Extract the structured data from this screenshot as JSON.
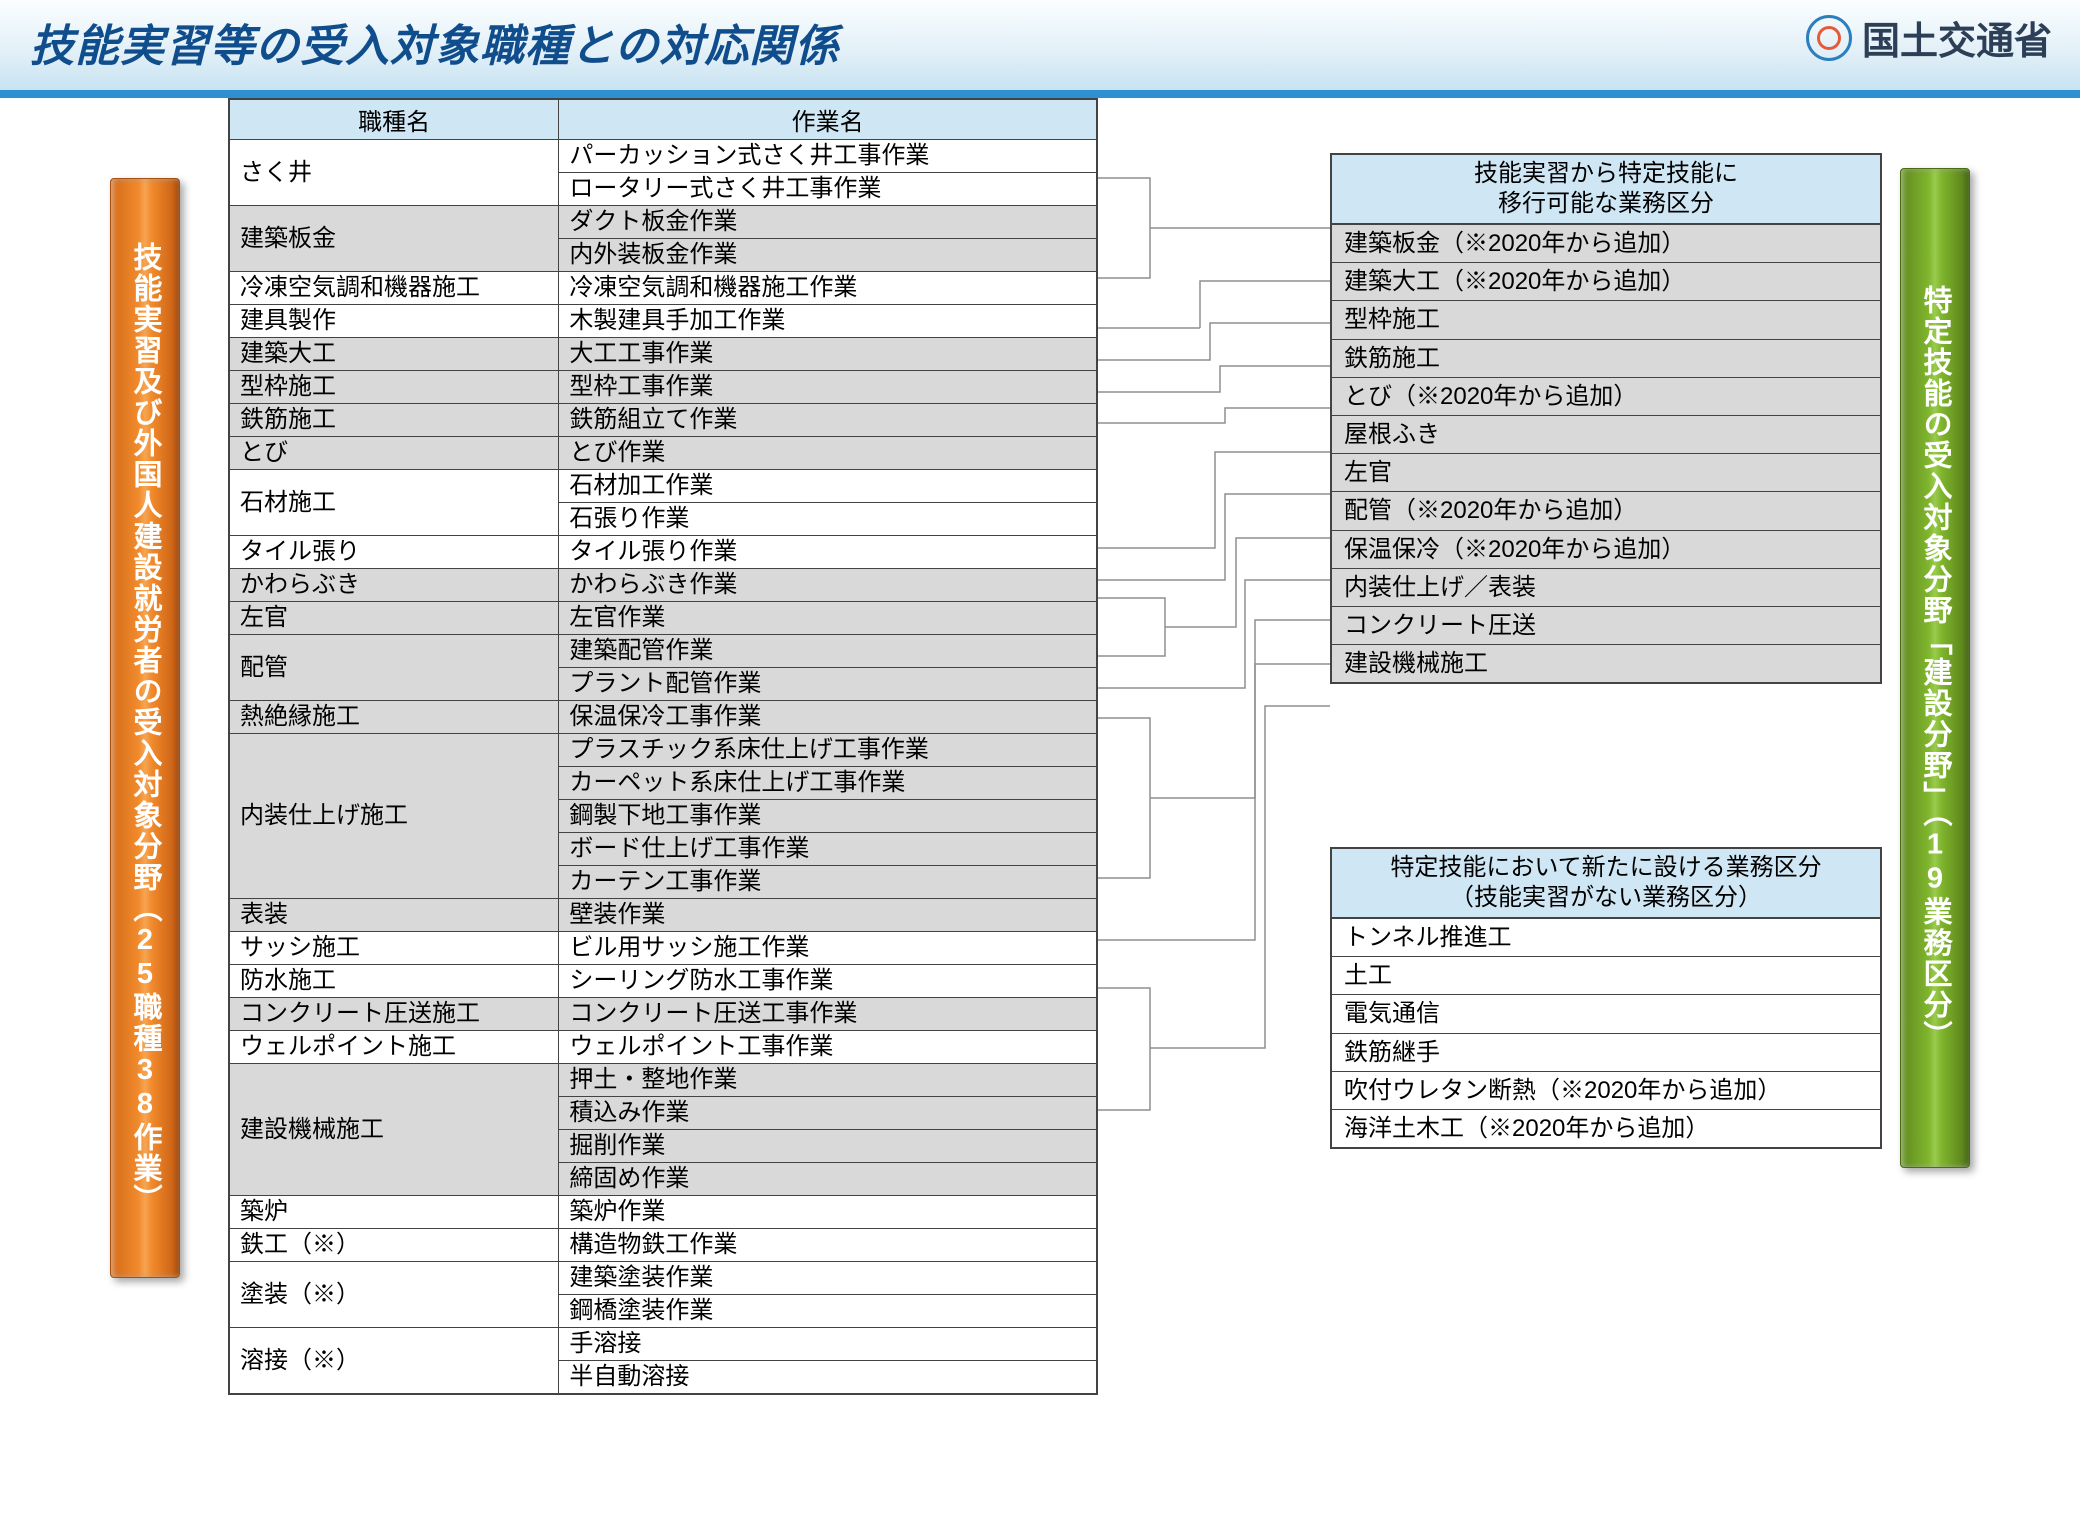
{
  "header": {
    "title": "技能実習等の受入対象職種との対応関係",
    "ministry": "国土交通省"
  },
  "leftBanner": "技能実習及び外国人建設就労者の受入対象分野（25職種38作業）",
  "rightBanner": "特定技能の受入対象分野「建設分野」（19業務区分）",
  "table": {
    "col1": "職種名",
    "col2": "作業名",
    "rows": [
      {
        "job": "さく井",
        "ops": [
          "パーカッション式さく井工事作業",
          "ロータリー式さく井工事作業"
        ],
        "shade": false
      },
      {
        "job": "建築板金",
        "ops": [
          "ダクト板金作業",
          "内外装板金作業"
        ],
        "shade": true
      },
      {
        "job": "冷凍空気調和機器施工",
        "ops": [
          "冷凍空気調和機器施工作業"
        ],
        "shade": false
      },
      {
        "job": "建具製作",
        "ops": [
          "木製建具手加工作業"
        ],
        "shade": false
      },
      {
        "job": "建築大工",
        "ops": [
          "大工工事作業"
        ],
        "shade": true
      },
      {
        "job": "型枠施工",
        "ops": [
          "型枠工事作業"
        ],
        "shade": true
      },
      {
        "job": "鉄筋施工",
        "ops": [
          "鉄筋組立て作業"
        ],
        "shade": true
      },
      {
        "job": "とび",
        "ops": [
          "とび作業"
        ],
        "shade": true
      },
      {
        "job": "石材施工",
        "ops": [
          "石材加工作業",
          "石張り作業"
        ],
        "shade": false
      },
      {
        "job": "タイル張り",
        "ops": [
          "タイル張り作業"
        ],
        "shade": false
      },
      {
        "job": "かわらぶき",
        "ops": [
          "かわらぶき作業"
        ],
        "shade": true
      },
      {
        "job": "左官",
        "ops": [
          "左官作業"
        ],
        "shade": true
      },
      {
        "job": "配管",
        "ops": [
          "建築配管作業",
          "プラント配管作業"
        ],
        "shade": true
      },
      {
        "job": "熱絶縁施工",
        "ops": [
          "保温保冷工事作業"
        ],
        "shade": true
      },
      {
        "job": "内装仕上げ施工",
        "ops": [
          "プラスチック系床仕上げ工事作業",
          "カーペット系床仕上げ工事作業",
          "鋼製下地工事作業",
          "ボード仕上げ工事作業",
          "カーテン工事作業"
        ],
        "shade": true
      },
      {
        "job": "表装",
        "ops": [
          "壁装作業"
        ],
        "shade": true
      },
      {
        "job": "サッシ施工",
        "ops": [
          "ビル用サッシ施工作業"
        ],
        "shade": false
      },
      {
        "job": "防水施工",
        "ops": [
          "シーリング防水工事作業"
        ],
        "shade": false
      },
      {
        "job": "コンクリート圧送施工",
        "ops": [
          "コンクリート圧送工事作業"
        ],
        "shade": true
      },
      {
        "job": "ウェルポイント施工",
        "ops": [
          "ウェルポイント工事作業"
        ],
        "shade": false
      },
      {
        "job": "建設機械施工",
        "ops": [
          "押土・整地作業",
          "積込み作業",
          "掘削作業",
          "締固め作業"
        ],
        "shade": true
      },
      {
        "job": "築炉",
        "ops": [
          "築炉作業"
        ],
        "shade": false
      },
      {
        "job": "鉄工（※）",
        "ops": [
          "構造物鉄工作業"
        ],
        "shade": false
      },
      {
        "job": "塗装（※）",
        "ops": [
          "建築塗装作業",
          "鋼橋塗装作業"
        ],
        "shade": false
      },
      {
        "job": "溶接（※）",
        "ops": [
          "手溶接",
          "半自動溶接"
        ],
        "shade": false
      }
    ]
  },
  "rightA": {
    "head1": "技能実習から特定技能に",
    "head2": "移行可能な業務区分",
    "items": [
      "建築板金（※2020年から追加）",
      "建築大工（※2020年から追加）",
      "型枠施工",
      "鉄筋施工",
      "とび（※2020年から追加）",
      "屋根ふき",
      "左官",
      "配管（※2020年から追加）",
      "保温保冷（※2020年から追加）",
      "内装仕上げ／表装",
      "コンクリート圧送",
      "建設機械施工"
    ]
  },
  "rightB": {
    "head1": "特定技能において新たに設ける業務区分",
    "head2": "（技能実習がない業務区分）",
    "items": [
      "トンネル推進工",
      "土工",
      "電気通信",
      "鉄筋継手",
      "吹付ウレタン断熱（※2020年から追加）",
      "海洋土木工（※2020年から追加）"
    ]
  }
}
